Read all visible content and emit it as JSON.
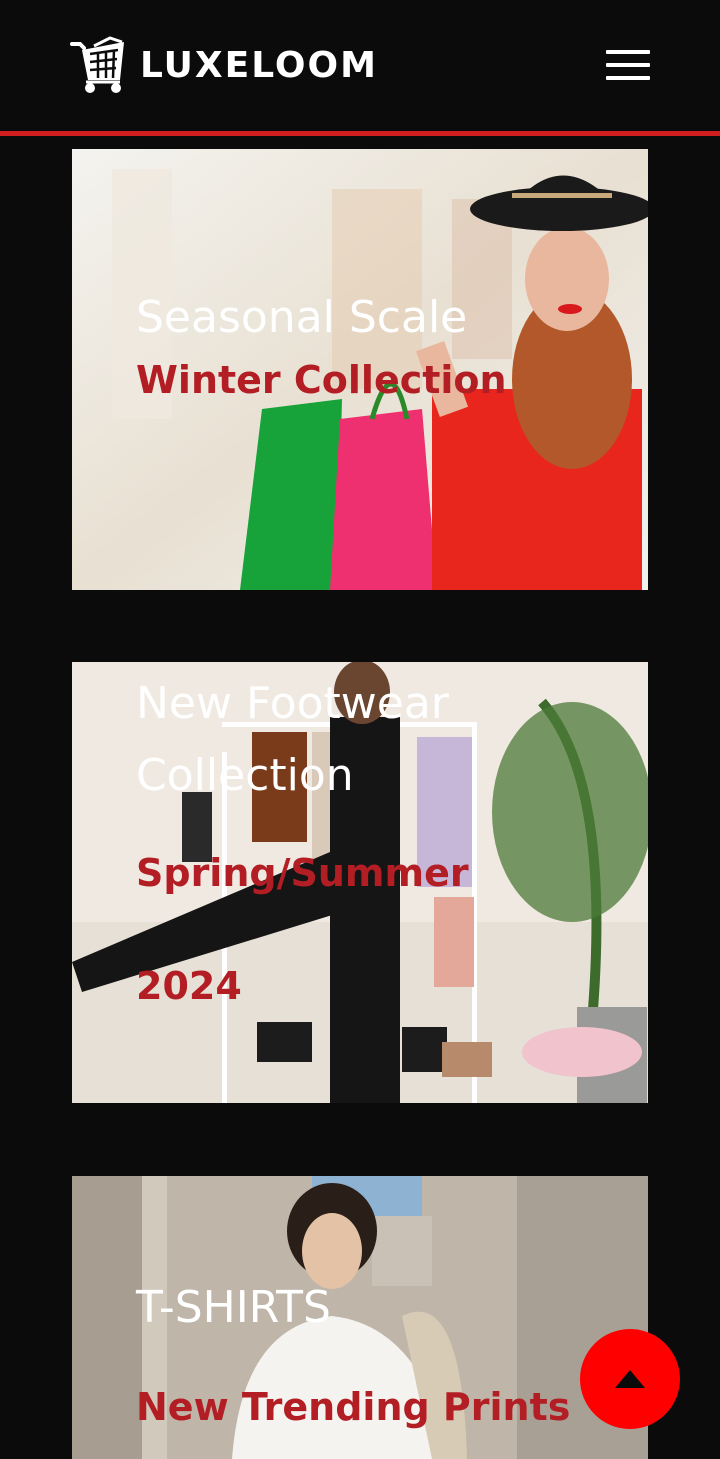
{
  "brand": {
    "name": "LUXELOOM",
    "logo_icon": "shopping-cart-icon"
  },
  "header": {
    "menu_icon": "hamburger-menu-icon",
    "accent_line_color": "#d11f1f"
  },
  "cards": [
    {
      "title": "Seasonal Scale",
      "subtitle": "Winter Collection"
    },
    {
      "title_lines": [
        "New Footwear",
        "Collection"
      ],
      "subtitle_lines": [
        "Spring/Summer",
        "2024"
      ]
    },
    {
      "title": "T-SHIRTS",
      "subtitle": "New Trending Prints"
    }
  ],
  "scroll_top": {
    "icon": "arrow-up-icon",
    "color": "#ff0000"
  },
  "colors": {
    "background": "#0b0b0b",
    "subtitle": "#b21e24",
    "title": "#ffffff"
  }
}
